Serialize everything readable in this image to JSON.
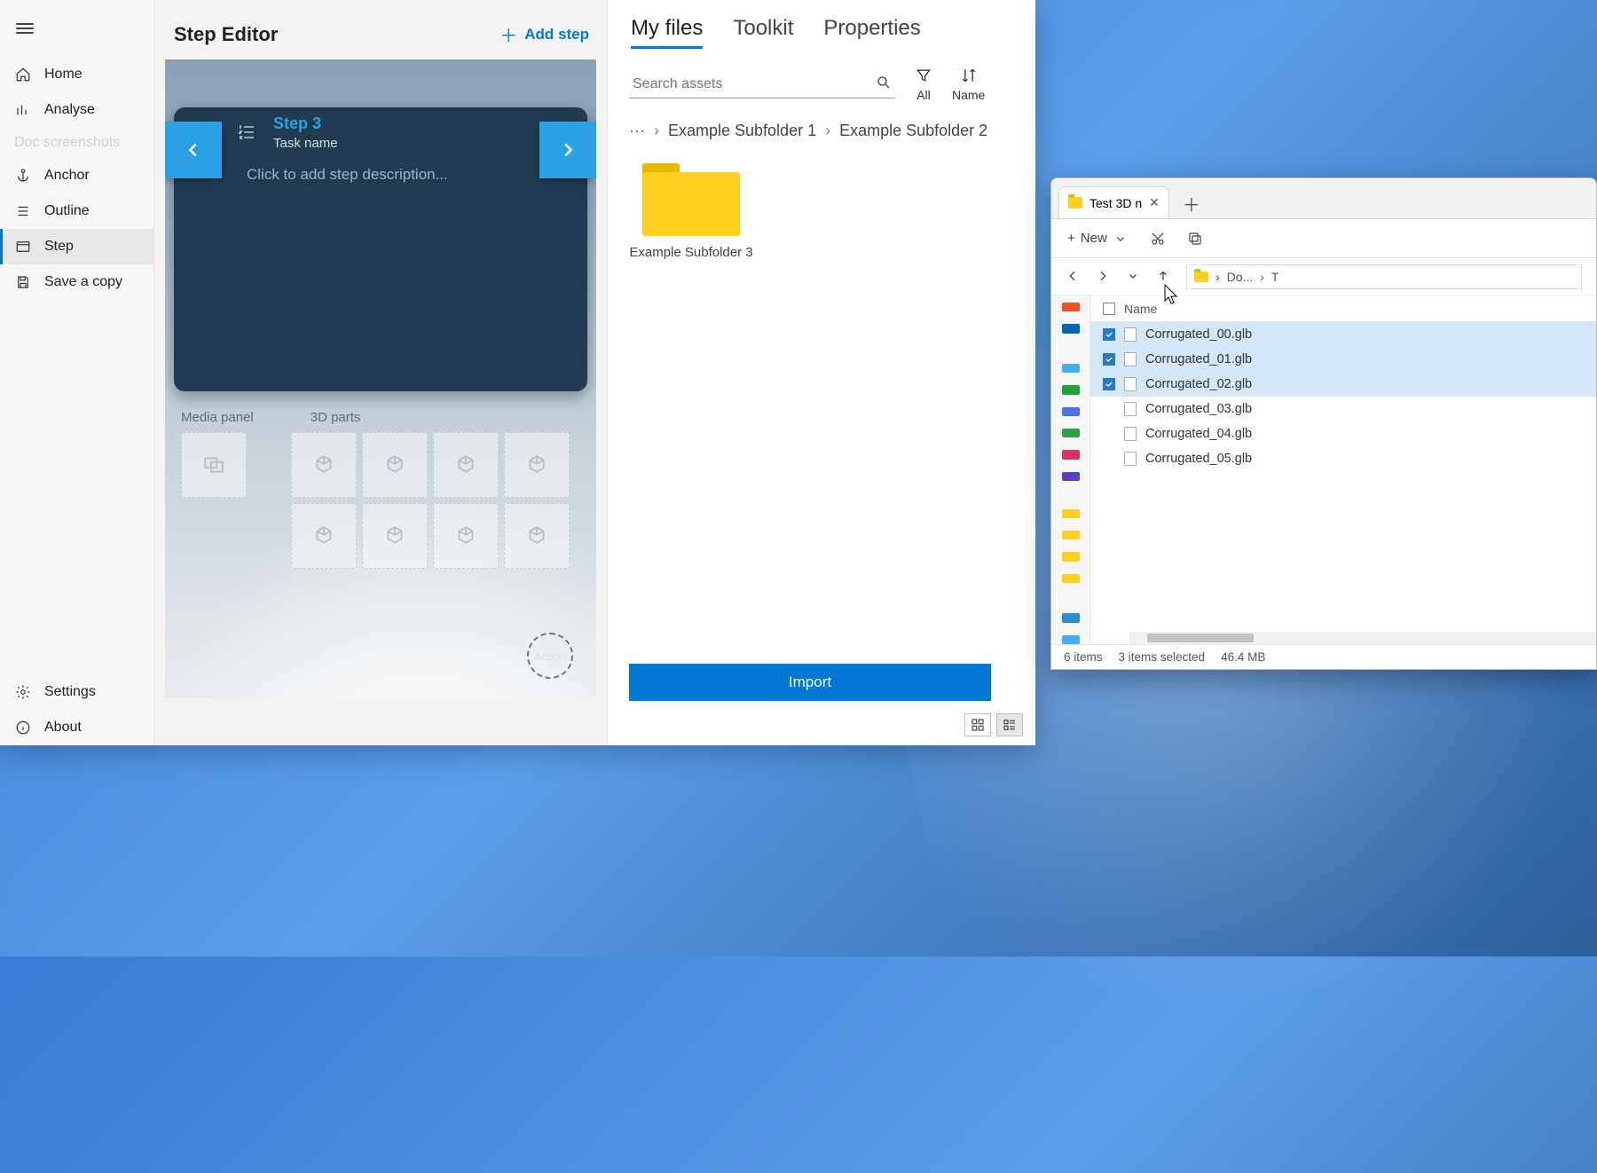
{
  "sidebar": {
    "home": "Home",
    "analyse": "Analyse",
    "faded": "Doc screenshots",
    "anchor": "Anchor",
    "outline": "Outline",
    "step": "Step",
    "save_copy": "Save a copy",
    "settings": "Settings",
    "about": "About"
  },
  "center": {
    "title": "Step Editor",
    "add_step": "Add step",
    "step_title": "Step 3",
    "task_name": "Task name",
    "step_description_placeholder": "Click to add step description...",
    "action_label": "Action",
    "panels": {
      "media": "Media panel",
      "parts": "3D parts"
    }
  },
  "right": {
    "tabs": {
      "my_files": "My files",
      "toolkit": "Toolkit",
      "properties": "Properties"
    },
    "search_placeholder": "Search assets",
    "toolbar": {
      "filter": "All",
      "sort": "Name"
    },
    "breadcrumb": {
      "item1": "Example Subfolder 1",
      "item2": "Example Subfolder 2"
    },
    "folders": [
      {
        "name": "Example Subfolder 3"
      }
    ],
    "import": "Import"
  },
  "explorer": {
    "tab_title": "Test 3D n",
    "toolbar": {
      "new": "New"
    },
    "address": {
      "seg1": "Do...",
      "seg2": "T"
    },
    "columns": {
      "name": "Name"
    },
    "files": [
      {
        "name": "Corrugated_00.glb",
        "selected": true
      },
      {
        "name": "Corrugated_01.glb",
        "selected": true
      },
      {
        "name": "Corrugated_02.glb",
        "selected": true
      },
      {
        "name": "Corrugated_03.glb",
        "selected": false
      },
      {
        "name": "Corrugated_04.glb",
        "selected": false
      },
      {
        "name": "Corrugated_05.glb",
        "selected": false
      }
    ],
    "status": {
      "count": "6 items",
      "selection": "3 items selected",
      "size": "46.4 MB"
    }
  }
}
